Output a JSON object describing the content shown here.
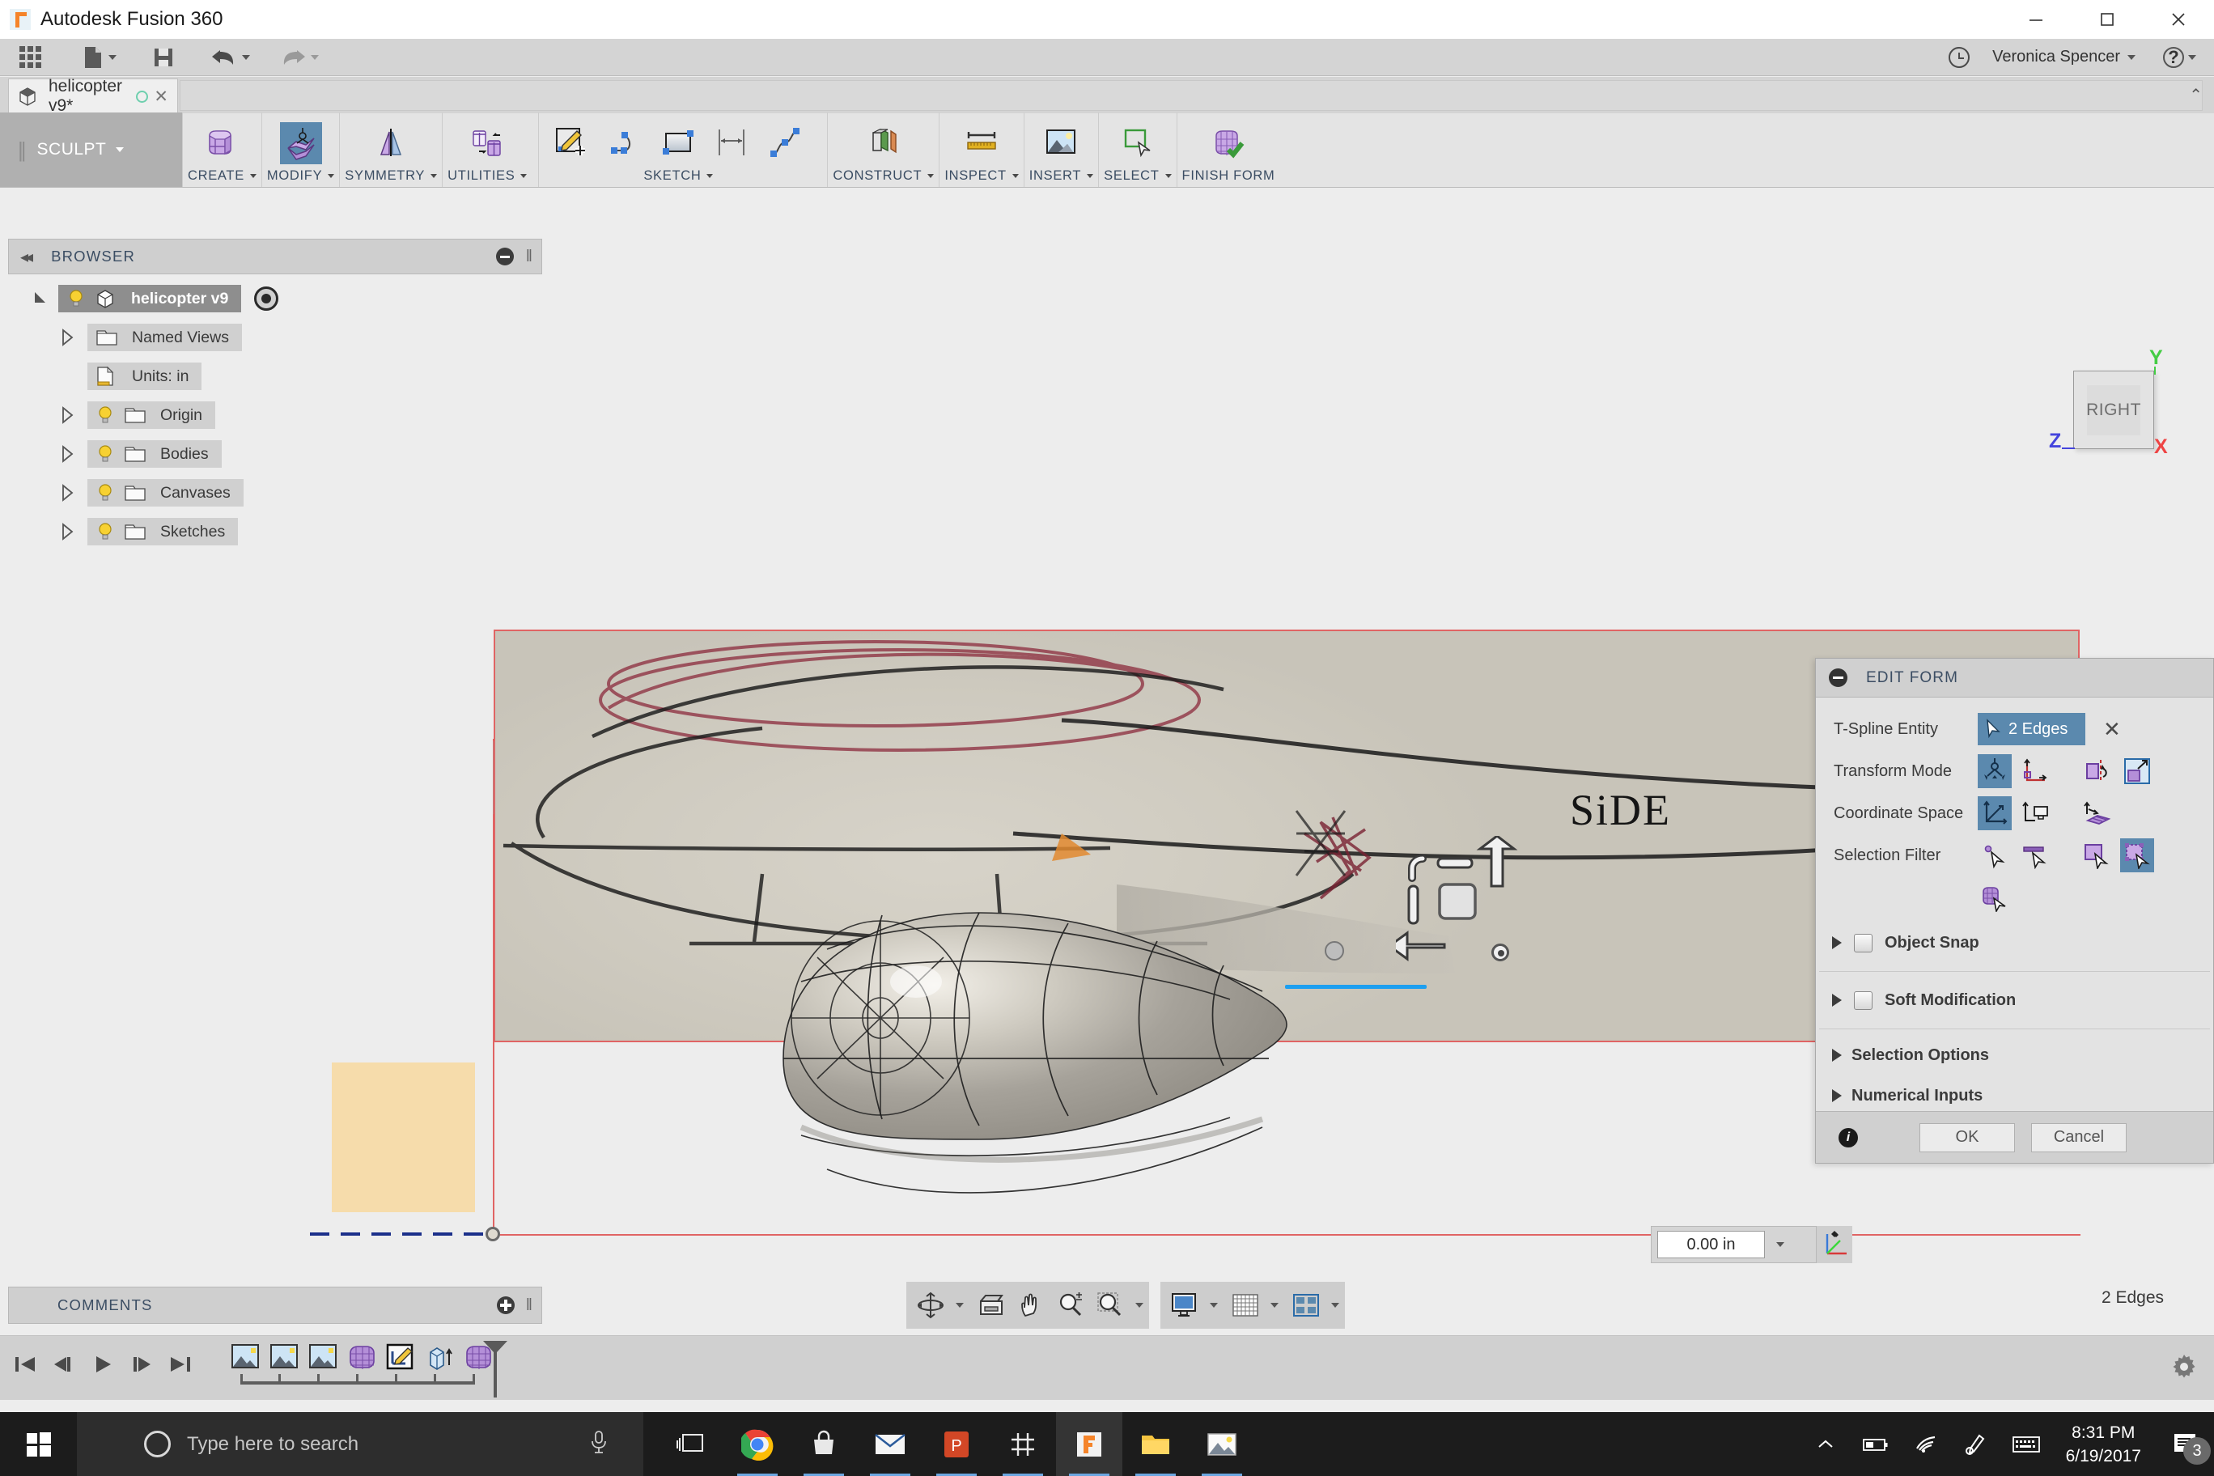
{
  "window": {
    "app_title": "Autodesk Fusion 360",
    "logo_icon": "fusion-f-logo",
    "minimize_icon": "minimize-icon",
    "maximize_icon": "maximize-icon",
    "close_icon": "close-icon"
  },
  "quick_access": {
    "app_grid_icon": "app-grid-icon",
    "new_doc_icon": "new-document-icon",
    "save_icon": "save-icon",
    "undo_icon": "undo-icon",
    "redo_icon": "redo-icon",
    "clock_icon": "clock-icon",
    "user_name": "Veronica Spencer",
    "help_icon": "help-question-icon"
  },
  "tabstrip": {
    "doc_icon": "cube-icon",
    "doc_label": "helicopter v9*",
    "sync_icon": "sync-circle-icon",
    "close_icon": "close-icon",
    "ribbon_collapse_icon": "chevron-up-icon"
  },
  "ribbon": {
    "workspace": "SCULPT",
    "groups": [
      {
        "label": "CREATE",
        "icon": "create-tspline-box-icon",
        "active": false
      },
      {
        "label": "MODIFY",
        "icon": "modify-edit-form-icon",
        "active": true
      },
      {
        "label": "SYMMETRY",
        "icon": "symmetry-mirror-icon",
        "active": false
      },
      {
        "label": "UTILITIES",
        "icon": "utilities-convert-icon",
        "active": false
      },
      {
        "label": "SKETCH",
        "icon": "sketch-group-icon",
        "active": false
      },
      {
        "label": "CONSTRUCT",
        "icon": "construct-plane-icon",
        "active": false
      },
      {
        "label": "INSPECT",
        "icon": "inspect-measure-icon",
        "active": false
      },
      {
        "label": "INSERT",
        "icon": "insert-canvas-image-icon",
        "active": false
      },
      {
        "label": "SELECT",
        "icon": "select-window-icon",
        "active": false
      },
      {
        "label": "FINISH FORM",
        "icon": "finish-form-icon",
        "active": false
      }
    ],
    "sketch_tools": [
      "create-sketch-icon",
      "arc-icon",
      "rectangle-icon",
      "dimension-icon",
      "spline-icon"
    ]
  },
  "browser": {
    "collapse_icon": "collapse-left-icon",
    "title": "BROWSER",
    "minimize_icon": "minus-circle-icon",
    "grip_icon": "grip-icon",
    "items": [
      {
        "label": "helicopter v9",
        "icon": "cube-icon",
        "bulb": true,
        "expanded": true,
        "selected": true,
        "indent": 0,
        "target": true
      },
      {
        "label": "Named Views",
        "icon": "folder-icon",
        "bulb": false,
        "expanded": false,
        "selected": false,
        "indent": 1,
        "target": false
      },
      {
        "label": "Units: in",
        "icon": "units-doc-icon",
        "bulb": false,
        "expanded": null,
        "selected": false,
        "indent": 1,
        "target": false
      },
      {
        "label": "Origin",
        "icon": "folder-icon",
        "bulb": true,
        "expanded": false,
        "selected": false,
        "indent": 1,
        "target": false
      },
      {
        "label": "Bodies",
        "icon": "folder-icon",
        "bulb": true,
        "expanded": false,
        "selected": false,
        "indent": 1,
        "target": false
      },
      {
        "label": "Canvases",
        "icon": "folder-icon",
        "bulb": true,
        "expanded": false,
        "selected": false,
        "indent": 1,
        "target": false
      },
      {
        "label": "Sketches",
        "icon": "folder-icon",
        "bulb": true,
        "expanded": false,
        "selected": false,
        "indent": 1,
        "target": false
      }
    ]
  },
  "viewport": {
    "canvas_annotation": "SiDE",
    "dimension_value": "0.00 in",
    "dimension_caret_icon": "chevron-down-icon",
    "manipulator_icon": "transform-manipulator-gizmo",
    "mini_axis_icon": "drag-axis-icon",
    "viewcube": {
      "face_label": "RIGHT",
      "axis_y": "Y",
      "axis_z": "Z",
      "axis_x": "X",
      "axis_y_color": "#44cc44",
      "axis_z_color": "#4444dd",
      "axis_x_color": "#ee4444"
    },
    "selection_color": "#1d9ff0",
    "canvas_border_color": "#e06464"
  },
  "edit_form": {
    "collapse_icon": "minus-circle-icon",
    "title": "EDIT FORM",
    "rows": [
      {
        "label": "T-Spline Entity",
        "type": "selection",
        "chip_icon": "cursor-arrow-icon",
        "chip_value": "2 Edges",
        "clear_icon": "close-x-icon"
      },
      {
        "label": "Transform Mode",
        "type": "buttons",
        "buttons": [
          {
            "icon": "transform-all-axes-icon",
            "active": true
          },
          {
            "icon": "transform-translate-icon",
            "active": false
          },
          {
            "icon": "transform-rotate-icon",
            "active": false
          },
          {
            "icon": "transform-scale-icon",
            "active": false
          }
        ]
      },
      {
        "label": "Coordinate Space",
        "type": "buttons",
        "buttons": [
          {
            "icon": "coord-world-space-icon",
            "active": true
          },
          {
            "icon": "coord-view-space-icon",
            "active": false
          },
          {
            "icon": "coord-local-space-icon",
            "active": false
          }
        ]
      },
      {
        "label": "Selection Filter",
        "type": "buttons",
        "buttons": [
          {
            "icon": "filter-vertex-icon",
            "active": false
          },
          {
            "icon": "filter-edge-icon",
            "active": false
          },
          {
            "icon": "filter-face-icon",
            "active": false
          },
          {
            "icon": "filter-body-box-icon",
            "active": true
          },
          {
            "icon": "filter-body-mesh-icon",
            "active": false
          }
        ]
      }
    ],
    "collapsibles": [
      {
        "label": "Object Snap",
        "expand_icon": "triangle-right-icon",
        "checkbox": false,
        "has_checkbox": true
      },
      {
        "label": "Soft Modification",
        "expand_icon": "triangle-right-icon",
        "checkbox": false,
        "has_checkbox": true
      },
      {
        "label": "Selection Options",
        "expand_icon": "triangle-right-icon",
        "checkbox": false,
        "has_checkbox": false
      },
      {
        "label": "Numerical Inputs",
        "expand_icon": "triangle-right-icon",
        "checkbox": false,
        "has_checkbox": false
      }
    ],
    "info_icon": "info-icon",
    "ok_label": "OK",
    "cancel_label": "Cancel",
    "ok_enabled": false
  },
  "comments": {
    "title": "COMMENTS",
    "add_icon": "plus-circle-icon",
    "grip_icon": "grip-icon"
  },
  "nav_toolbar": {
    "group1": [
      "orbit-icon",
      "orbit-caret-icon",
      "look-at-icon",
      "pan-hand-icon",
      "zoom-icon",
      "fit-icon",
      "fit-caret-icon"
    ],
    "group2": [
      "display-settings-icon",
      "display-caret-icon",
      "grid-snaps-icon",
      "grid-caret-icon",
      "viewports-icon",
      "viewports-caret-icon"
    ]
  },
  "status_bar": {
    "selection_text": "2 Edges"
  },
  "timeline": {
    "playback": [
      "go-to-beginning-icon",
      "step-back-icon",
      "play-icon",
      "step-forward-icon",
      "go-to-end-icon"
    ],
    "features": [
      "canvas-image-icon",
      "canvas-image-icon",
      "canvas-image-icon",
      "tspline-body-icon",
      "sketch-icon",
      "extrude-icon",
      "tspline-body-icon"
    ],
    "marker_icon": "timeline-marker-icon",
    "settings_icon": "gear-icon"
  },
  "taskbar": {
    "start_icon": "windows-start-icon",
    "search_placeholder": "Type here to search",
    "cortana_icon": "cortana-circle-icon",
    "mic_icon": "microphone-icon",
    "buttons": [
      {
        "icon": "task-view-icon",
        "running": false,
        "active": false
      },
      {
        "icon": "chrome-icon",
        "running": true,
        "active": false
      },
      {
        "icon": "microsoft-store-icon",
        "running": true,
        "active": false
      },
      {
        "icon": "mail-icon",
        "running": true,
        "active": false
      },
      {
        "icon": "powerpoint-icon",
        "running": true,
        "active": false
      },
      {
        "icon": "settings-hash-icon",
        "running": true,
        "active": false
      },
      {
        "icon": "fusion360-icon",
        "running": true,
        "active": true
      },
      {
        "icon": "file-explorer-icon",
        "running": true,
        "active": false
      },
      {
        "icon": "photos-icon",
        "running": true,
        "active": false
      }
    ],
    "tray": [
      "show-hidden-icons-icon",
      "battery-icon",
      "wifi-icon",
      "pen-workspace-icon",
      "touch-keyboard-icon"
    ],
    "time": "8:31 PM",
    "date": "6/19/2017",
    "notification_icon": "action-center-icon",
    "notification_count": "3"
  }
}
